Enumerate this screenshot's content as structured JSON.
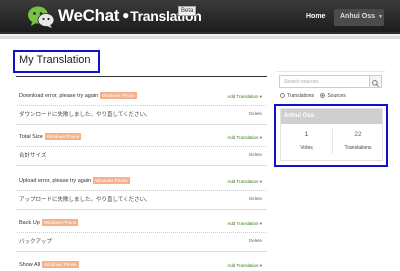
{
  "header": {
    "brand": "WeChat",
    "brand_sub": "Translation",
    "beta": "Beta",
    "nav_home": "Home",
    "nav_user": "Anhui Oss",
    "logo_icon": "wechat-logo-icon"
  },
  "page": {
    "title": "My Translation"
  },
  "items": [
    {
      "source": "Download error, please try again",
      "tag": "Windows Phone",
      "add": "Add Translation ▾",
      "translation": "ダウンロードに失敗しました。やり直してください。",
      "delete": "Delete"
    },
    {
      "source": "Total Size",
      "tag": "Windows Phone",
      "add": "Add Translation ▾",
      "translation": "合計サイズ",
      "delete": "Delete"
    },
    {
      "source": "Upload error, please try again",
      "tag": "Windows Phone",
      "add": "Add Translation ▾",
      "translation": "アップロードに失敗しました。やり直してください。",
      "delete": "Delete"
    },
    {
      "source": "Back Up",
      "tag": "Windows Phone",
      "add": "Add Translation ▾",
      "translation": "バックアップ",
      "delete": "Delete"
    },
    {
      "source": "Show All",
      "tag": "Windows Phone",
      "add": "Add Translation ▾",
      "translation": "",
      "delete": ""
    }
  ],
  "sidebar": {
    "search_placeholder": "Search sources",
    "radio_translations": "Translations",
    "radio_sources": "Sources",
    "selected": "Sources",
    "user": "Anhui Oss",
    "votes_count": "1",
    "votes_label": "Votes",
    "translations_count": "22",
    "translations_label": "Translations"
  }
}
